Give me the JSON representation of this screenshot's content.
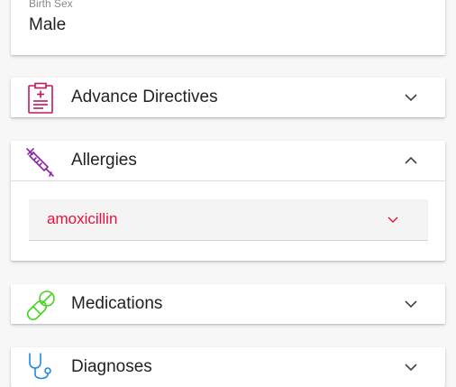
{
  "birth_sex": {
    "label": "Birth Sex",
    "value": "Male"
  },
  "sections": [
    {
      "title": "Advance Directives",
      "icon": "clipboard-icon",
      "expanded": false,
      "icon_color": "#c2185b"
    },
    {
      "title": "Allergies",
      "icon": "syringe-icon",
      "expanded": true,
      "icon_color": "#8e24aa"
    },
    {
      "title": "Medications",
      "icon": "pills-icon",
      "expanded": false,
      "icon_color": "#43d41c"
    },
    {
      "title": "Diagnoses",
      "icon": "stethoscope-icon",
      "expanded": false,
      "icon_color": "#1e88e5"
    }
  ],
  "allergies": {
    "items": [
      {
        "name": "amoxicillin"
      }
    ]
  },
  "colors": {
    "allergy_text": "#e8103c",
    "chevron": "#444444"
  }
}
